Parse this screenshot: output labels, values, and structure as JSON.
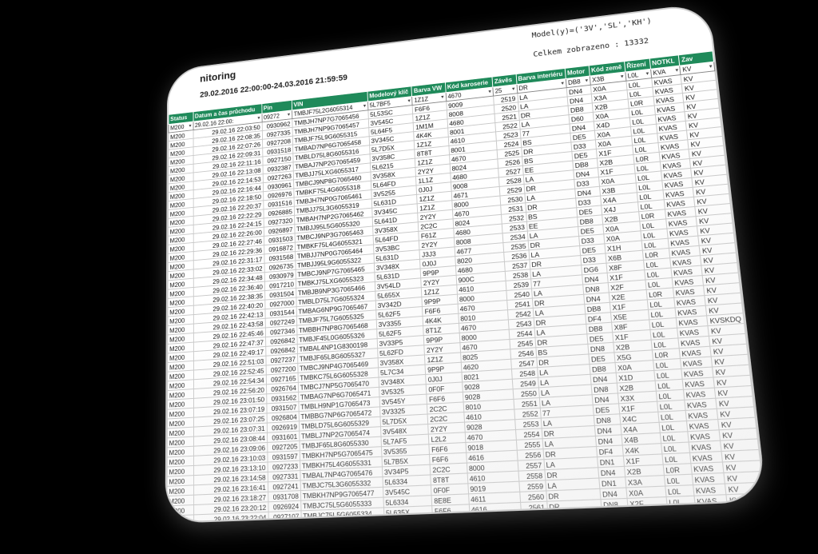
{
  "header": {
    "title": "nitoring",
    "period": "29.02.2016 22:00:00-24.03.2016 21:59:59",
    "model": "Model(y)=('3V','SL','KH')",
    "total": "Celkem zobrazeno : 13332"
  },
  "columns": [
    "Status",
    "Datum a čas průchodu",
    "Pin",
    "VIN",
    "Modelový klíč",
    "Barva VW",
    "Kód karoserie",
    "Závěs",
    "Barva interiéru",
    "Motor",
    "Kód země",
    "Řízení",
    "NOTKL",
    "Zav"
  ],
  "filters": [
    "M200",
    "29.02.16 22:00:",
    "09272",
    "TMBJF75L2G6055314",
    "5L7BF5",
    "1Z1Z",
    "4670",
    "25",
    "DR",
    "DB8",
    "X3B",
    "L0L",
    "KVA",
    "KV"
  ],
  "rows": [
    [
      "M200",
      "29.02.16 22:03:50",
      "0930962",
      "TMBJH7NP7G7065456",
      "5L53SC",
      "F6F6",
      "9009",
      "2519",
      "LA",
      "DN4",
      "X0A",
      "L0L",
      "KVAS",
      "KV"
    ],
    [
      "M200",
      "29.02.16 22:08:35",
      "0927335",
      "TMBJH7NP9G7065457",
      "3V545C",
      "1Z1Z",
      "8008",
      "2520",
      "LA",
      "DN4",
      "X3A",
      "L0L",
      "KVAS",
      "KV"
    ],
    [
      "M200",
      "29.02.16 22:07:26",
      "0927208",
      "TMBJF75L9G6055315",
      "5L64F5",
      "1M1M",
      "4680",
      "2521",
      "DR",
      "DB8",
      "X2B",
      "L0R",
      "KVAS",
      "KV"
    ],
    [
      "M200",
      "29.02.16 22:09:31",
      "0931518",
      "TMBAD7NP6G7065458",
      "3V345C",
      "4K4K",
      "8001",
      "2522",
      "LA",
      "D60",
      "X0A",
      "L0L",
      "KVAS",
      "KV"
    ],
    [
      "M200",
      "29.02.16 22:11:16",
      "0927150",
      "TMBLD75L8G6055316",
      "5L7D5X",
      "1Z1Z",
      "4610",
      "2523",
      "77",
      "DN4",
      "X4D",
      "L0L",
      "KVAS",
      "KV"
    ],
    [
      "M200",
      "29.02.16 22:13:08",
      "0932387",
      "TMBAJ7NP2G7065459",
      "3V358C",
      "8T8T",
      "8001",
      "2524",
      "BS",
      "DE5",
      "X0A",
      "L0L",
      "KVAS",
      "KV"
    ],
    [
      "M200",
      "29.02.16 22:14:53",
      "0927263",
      "TMBJJ75LXG6055317",
      "5L6215",
      "1Z1Z",
      "4670",
      "2525",
      "DR",
      "D33",
      "X0A",
      "L0L",
      "KVAS",
      "KV"
    ],
    [
      "M200",
      "29.02.16 22:16:44",
      "0930961",
      "TMBCJ9NP8G7065460",
      "3V358X",
      "2Y2Y",
      "8024",
      "2526",
      "BS",
      "DE5",
      "X1F",
      "L0L",
      "KVAS",
      "KV"
    ],
    [
      "M200",
      "29.02.16 22:18:50",
      "0926976",
      "TMBKF75L4G6055318",
      "5L64FD",
      "1L1Z",
      "4680",
      "2527",
      "EE",
      "DB8",
      "X2B",
      "L0R",
      "KVAS",
      "KV"
    ],
    [
      "M200",
      "29.02.16 22:20:37",
      "0931516",
      "TMBJH7NP0G7065461",
      "3V5255",
      "0J0J",
      "9008",
      "2528",
      "LA",
      "DN4",
      "X1F",
      "L0L",
      "KVAS",
      "KV"
    ],
    [
      "M200",
      "29.02.16 22:22:29",
      "0926885",
      "TMBJJ75L3G6055319",
      "5L631D",
      "1Z1Z",
      "4671",
      "2529",
      "DR",
      "D33",
      "X0A",
      "L0L",
      "KVAS",
      "KV"
    ],
    [
      "M200",
      "29.02.16 22:24:15",
      "0927320",
      "TMBAH7NP2G7065462",
      "3V345C",
      "1Z1Z",
      "8000",
      "2530",
      "LA",
      "DN4",
      "X3B",
      "L0L",
      "KVAS",
      "KV"
    ],
    [
      "M200",
      "29.02.16 22:26:00",
      "0926897",
      "TMBJJ95L5G6055320",
      "5L641D",
      "2Y2Y",
      "4670",
      "2531",
      "DR",
      "D33",
      "X4A",
      "L0L",
      "KVAS",
      "KV"
    ],
    [
      "M200",
      "29.02.16 22:27:46",
      "0931503",
      "TMBCJ9NP3G7065463",
      "3V358X",
      "2C2C",
      "8024",
      "2532",
      "BS",
      "DE5",
      "X4J",
      "L0L",
      "KVAS",
      "KV"
    ],
    [
      "M200",
      "29.02.16 22:29:36",
      "0916872",
      "TMBKF75L4G6055321",
      "5L64FD",
      "F61Z",
      "4680",
      "2533",
      "EE",
      "DB8",
      "X2B",
      "L0R",
      "KVAS",
      "KV"
    ],
    [
      "M200",
      "29.02.16 22:31:17",
      "0931568",
      "TMBJJ7NP0G7065464",
      "3V53BC",
      "2Y2Y",
      "8008",
      "2534",
      "LA",
      "DE5",
      "X0A",
      "L0L",
      "KVAS",
      "KV"
    ],
    [
      "M200",
      "29.02.16 22:33:02",
      "0926735",
      "TMBJJ95L9G6055322",
      "5L631D",
      "J3J3",
      "4677",
      "2535",
      "DR",
      "D33",
      "X0A",
      "L0L",
      "KVAS",
      "KV"
    ],
    [
      "M200",
      "29.02.16 22:34:48",
      "0930979",
      "TMBCJ9NP7G7065465",
      "3V348X",
      "0J0J",
      "8020",
      "2536",
      "LA",
      "DE5",
      "X1H",
      "L0L",
      "KVAS",
      "KV"
    ],
    [
      "M200",
      "29.02.16 22:36:40",
      "0917210",
      "TMBKJ75LXG6055323",
      "5L631D",
      "9P9P",
      "4680",
      "2537",
      "DR",
      "D33",
      "X6B",
      "L0R",
      "KVAS",
      "KV"
    ],
    [
      "M200",
      "29.02.16 22:38:35",
      "0931504",
      "TMBJB9NP3G7065466",
      "3V54LD",
      "2Y2Y",
      "900C",
      "2538",
      "LA",
      "DG6",
      "X8F",
      "L0L",
      "KVAS",
      "KV"
    ],
    [
      "M200",
      "29.02.16 22:40:20",
      "0927000",
      "TMBLD75L7G6055324",
      "5L655X",
      "1Z1Z",
      "4610",
      "2539",
      "77",
      "DN4",
      "X1F",
      "L0L",
      "KVAS",
      "KV"
    ],
    [
      "M200",
      "29.02.16 22:42:13",
      "0931544",
      "TMBAG6NP9G7065467",
      "3V342D",
      "9P9P",
      "8000",
      "2540",
      "LA",
      "DN8",
      "X2F",
      "L0L",
      "KVAS",
      "KV"
    ],
    [
      "M200",
      "29.02.16 22:43:58",
      "0927249",
      "TMBJF75L7G6055325",
      "5L62F5",
      "F6F6",
      "4670",
      "2541",
      "DR",
      "DN4",
      "X2E",
      "L0R",
      "KVAS",
      "KV"
    ],
    [
      "M200",
      "29.02.16 22:45:46",
      "0927346",
      "TMBBH7NP8G7065468",
      "3V3355",
      "4K4K",
      "8010",
      "2542",
      "LA",
      "DB8",
      "X1F",
      "L0L",
      "KVAS",
      "KV"
    ],
    [
      "M200",
      "29.02.16 22:47:37",
      "0926842",
      "TMBJF45L0G6055326",
      "5L62F5",
      "8T1Z",
      "4670",
      "2543",
      "DR",
      "DF4",
      "X5E",
      "L0L",
      "KVAS",
      "KV"
    ],
    [
      "M200",
      "29.02.16 22:49:17",
      "0926842",
      "TMBAL4NP1G8300198",
      "3V33P5",
      "9P9P",
      "8000",
      "2544",
      "LA",
      "DB8",
      "X8F",
      "L0L",
      "KVAS",
      "KVSKDQ"
    ],
    [
      "M200",
      "29.02.16 22:51:03",
      "0927237",
      "TMBJF65L8G6055327",
      "5L62FD",
      "2Y2Y",
      "4670",
      "2545",
      "DR",
      "DE5",
      "X1F",
      "L0L",
      "KVAS",
      "KV"
    ],
    [
      "M200",
      "29.02.16 22:52:45",
      "0927200",
      "TMBCJ9NP4G7065469",
      "3V358X",
      "1Z1Z",
      "8025",
      "2546",
      "BS",
      "DN8",
      "X2B",
      "L0L",
      "KVAS",
      "KV"
    ],
    [
      "M200",
      "29.02.16 22:54:34",
      "0927165",
      "TMBKC75L6G6055328",
      "5L7C34",
      "9P9P",
      "4620",
      "2547",
      "DR",
      "DE5",
      "X5G",
      "L0R",
      "KVAS",
      "KV"
    ],
    [
      "M200",
      "29.02.16 22:56:20",
      "0926764",
      "TMBCJ7NP5G7065470",
      "3V348X",
      "0J0J",
      "8021",
      "2548",
      "LA",
      "DB8",
      "X0A",
      "L0L",
      "KVAS",
      "KV"
    ],
    [
      "M200",
      "29.02.16 23:01:50",
      "0931562",
      "TMBAG7NP6G7065471",
      "3V5325",
      "0F0F",
      "9028",
      "2549",
      "LA",
      "DN4",
      "X1D",
      "L0L",
      "KVAS",
      "KV"
    ],
    [
      "M200",
      "29.02.16 23:07:19",
      "0931507",
      "TMBLH9NP1G7065473",
      "3V545Y",
      "F6F6",
      "9028",
      "2550",
      "LA",
      "DN8",
      "X2B",
      "L0L",
      "KVAS",
      "KV"
    ],
    [
      "M200",
      "29.02.16 23:07:25",
      "0926804",
      "TMBBG7NP6G7065472",
      "3V3325",
      "2C2C",
      "8010",
      "2551",
      "LA",
      "DN4",
      "X3X",
      "L0L",
      "KVAS",
      "KV"
    ],
    [
      "M200",
      "29.02.16 23:07:31",
      "0926919",
      "TMBLD75L6G6055329",
      "5L7D5X",
      "2C2C",
      "4610",
      "2552",
      "77",
      "DE5",
      "X1F",
      "L0L",
      "KVAS",
      "KV"
    ],
    [
      "M200",
      "29.02.16 23:08:44",
      "0931601",
      "TMBLJ7NP2G7065474",
      "3V548X",
      "2Y2Y",
      "9028",
      "2553",
      "LA",
      "DN8",
      "X4C",
      "L0L",
      "KVAS",
      "KV"
    ],
    [
      "M200",
      "29.02.16 23:09:06",
      "0927205",
      "TMBJF65L8G6055330",
      "5L7AF5",
      "L2L2",
      "4670",
      "2554",
      "DR",
      "DN4",
      "X4A",
      "L0L",
      "KVAS",
      "KV"
    ],
    [
      "M200",
      "29.02.16 23:10:03",
      "0931597",
      "TMBKH7NP5G7065475",
      "3V5355",
      "F6F6",
      "9018",
      "2555",
      "LA",
      "DN4",
      "X4B",
      "L0L",
      "KVAS",
      "KV"
    ],
    [
      "M200",
      "29.02.16 23:13:10",
      "0927233",
      "TMBKH75L4G6055331",
      "5L7B5X",
      "F6F6",
      "4616",
      "2556",
      "DR",
      "DF4",
      "X4K",
      "L0L",
      "KVAS",
      "KV"
    ],
    [
      "M200",
      "29.02.16 23:14:58",
      "0927331",
      "TMBAL7NP4G7065476",
      "3V34P5",
      "2C2C",
      "8000",
      "2557",
      "LA",
      "DN1",
      "X1F",
      "L0L",
      "KVAS",
      "KV"
    ],
    [
      "M200",
      "29.02.16 23:16:41",
      "0927241",
      "TMBJC75L3G6055332",
      "5L6334",
      "8T8T",
      "4610",
      "2558",
      "DR",
      "DN4",
      "X2B",
      "L0R",
      "KVAS",
      "KV"
    ],
    [
      "M200",
      "29.02.16 23:18:27",
      "0931708",
      "TMBKH7NP9G7065477",
      "3V545C",
      "0F0F",
      "9019",
      "2559",
      "LA",
      "DN1",
      "X3A",
      "L0L",
      "KVAS",
      "KV"
    ],
    [
      "M200",
      "29.02.16 23:20:12",
      "0926924",
      "TMBJC75L5G6055333",
      "5L6334",
      "8E8E",
      "4611",
      "2560",
      "DR",
      "DN4",
      "X0A",
      "L0L",
      "KVAS",
      "KV"
    ],
    [
      "M200",
      "29.02.16 23:22:04",
      "0927107",
      "TMBJC75L5G6055334",
      "5L635X",
      "F6F6",
      "4616",
      "2561",
      "DR",
      "DN8",
      "X2F",
      "L0L",
      "KVAS",
      "KV"
    ],
    [
      "M200",
      "29.02.16 23:23:58",
      "0927136",
      "TMBAG6NPXG7065478",
      "3V342D",
      "9P9P",
      "8000",
      "2562",
      "LA",
      "DN4",
      "X2E",
      "L0L",
      "KVAS",
      "KV"
    ],
    [
      "M200",
      "29.02.16 23:25:51",
      "0927164",
      "TMBBH7NP9G7065479",
      "3V3455",
      "2C2C",
      "8010",
      "2563",
      "LA",
      "DN4",
      "X1D",
      "L0L",
      "KVAS",
      "KV"
    ],
    [
      "M200",
      "29.02.16 23:27:39",
      "0927188",
      "TMBJD75L2G6055335",
      "5L6455",
      "8T8T",
      "4616",
      "2564",
      "DR",
      "DE5",
      "X0A",
      "L0L",
      "KVAS",
      "KV"
    ],
    [
      "M200",
      "29.02.16 23:29:43",
      "0931587",
      "TMBAJ7NP9G7065480",
      "3V3585",
      "8T8T",
      "8000",
      "2565",
      "BS",
      "DE5",
      "X0A",
      "L0L",
      "KVAS",
      "KV"
    ]
  ]
}
